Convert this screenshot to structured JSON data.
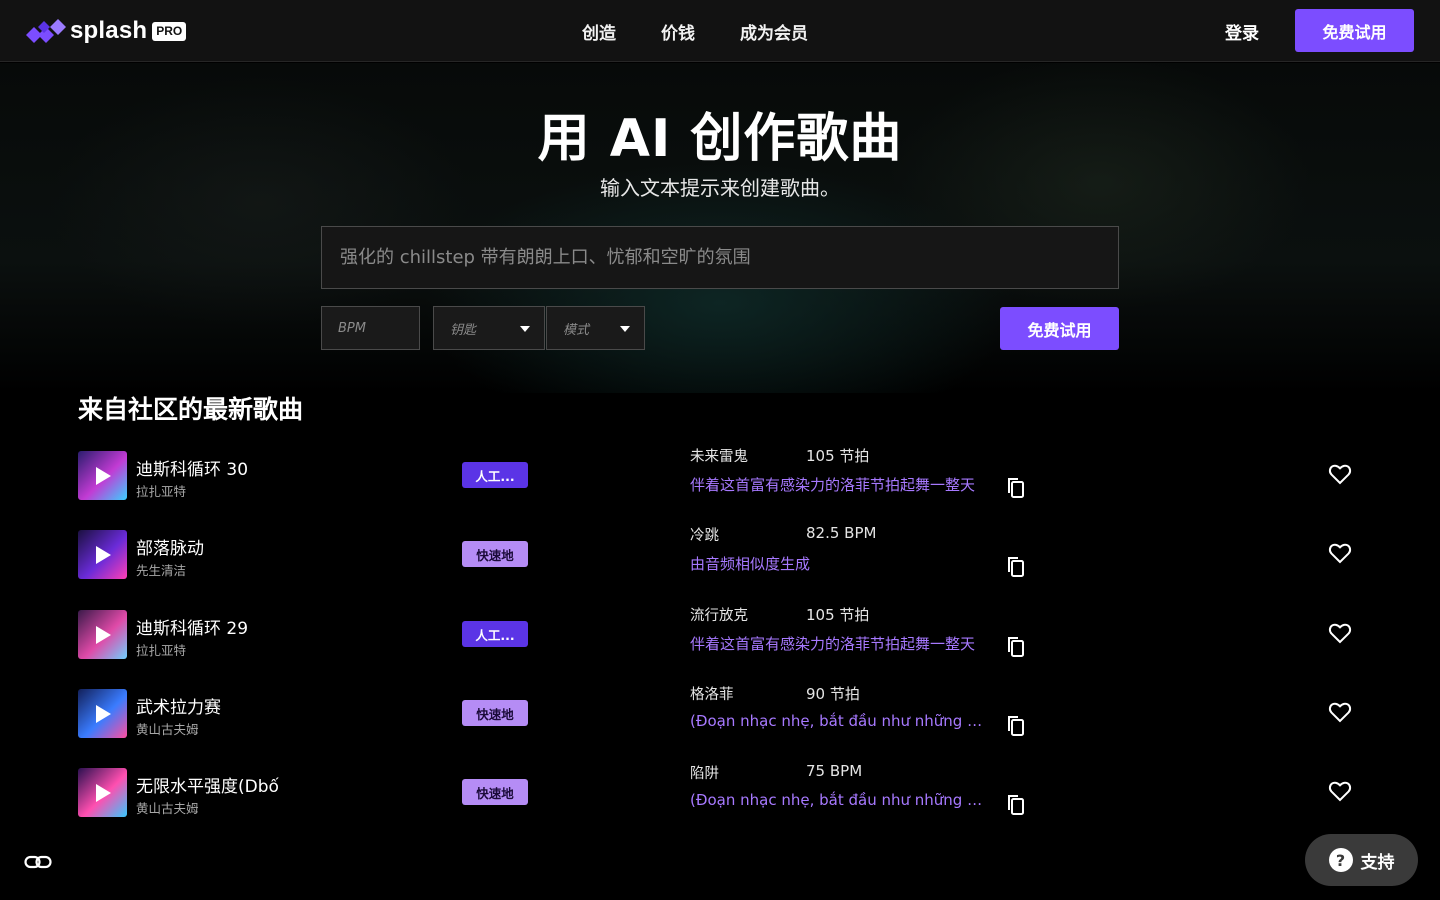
{
  "header": {
    "logo_text": "splash",
    "logo_badge": "PRO",
    "nav": [
      {
        "label": "创造"
      },
      {
        "label": "价钱"
      },
      {
        "label": "成为会员"
      }
    ],
    "login_label": "登录",
    "cta_label": "免费试用"
  },
  "hero": {
    "title": "用 AI 创作歌曲",
    "subtitle": "输入文本提示来创建歌曲。",
    "prompt_placeholder": "强化的 chillstep 带有朗朗上口、忧郁和空旷的氛围",
    "bpm_placeholder": "BPM",
    "key_placeholder": "钥匙",
    "mode_placeholder": "模式",
    "cta_label": "免费试用"
  },
  "section": {
    "title": "来自社区的最新歌曲"
  },
  "songs": [
    {
      "title": "迪斯科循环 30",
      "artist": "拉扎亚特",
      "badge": "人工...",
      "badge_type": "ai",
      "genre": "未来雷鬼",
      "bpm": "105 节拍",
      "prompt": "伴着这首富有感染力的洛菲节拍起舞一整天",
      "thumb_colors": [
        "#2a1d6e",
        "#c23bd4",
        "#3ad0ff"
      ]
    },
    {
      "title": "部落脉动",
      "artist": "先生清洁",
      "badge": "快速地",
      "badge_type": "fast",
      "genre": "冷跳",
      "bpm": "82.5 BPM",
      "prompt": "由音频相似度生成",
      "thumb_colors": [
        "#1b1040",
        "#6a2bd8",
        "#ff3fb5"
      ]
    },
    {
      "title": "迪斯科循环 29",
      "artist": "拉扎亚特",
      "badge": "人工...",
      "badge_type": "ai",
      "genre": "流行放克",
      "bpm": "105 节拍",
      "prompt": "伴着这首富有感染力的洛菲节拍起舞一整天",
      "thumb_colors": [
        "#3a1a4a",
        "#e04aa8",
        "#6fd0ff"
      ]
    },
    {
      "title": "武术拉力赛",
      "artist": "黄山古夫姆",
      "badge": "快速地",
      "badge_type": "fast",
      "genre": "格洛菲",
      "bpm": "90 节拍",
      "prompt": "(Đoạn nhạc nhẹ, bắt đầu như những nốt nhạc",
      "thumb_colors": [
        "#12205a",
        "#3a7cff",
        "#ff4ea0"
      ]
    },
    {
      "title": "无限水平强度(Dbố",
      "artist": "黄山古夫姆",
      "badge": "快速地",
      "badge_type": "fast",
      "genre": "陷阱",
      "bpm": "75 BPM",
      "prompt": "(Đoạn nhạc nhẹ, bắt đầu như những nốt nhạc",
      "thumb_colors": [
        "#2a1050",
        "#ff4fb0",
        "#36c8ff"
      ]
    }
  ],
  "support": {
    "label": "支持"
  },
  "colors": {
    "accent": "#7c4dff",
    "prompt_link": "#a779ff",
    "badge_ai": "#5b34e6",
    "badge_fast": "#b58cf5"
  }
}
